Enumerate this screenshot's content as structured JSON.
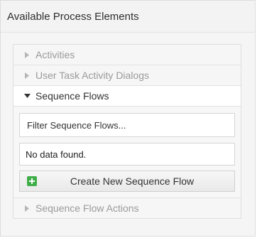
{
  "panel": {
    "title": "Available Process Elements"
  },
  "accordion": {
    "activities_label": "Activities",
    "dialogs_label": "User Task Activity Dialogs",
    "sequence_flows_label": "Sequence Flows",
    "sequence_flow_actions_label": "Sequence Flow Actions"
  },
  "sequence_flows": {
    "filter_placeholder": "Filter Sequence Flows...",
    "empty_text": "No data found.",
    "create_button_label": "Create New Sequence Flow"
  },
  "icons": {
    "collapsed": "caret-right-icon",
    "expanded": "caret-down-icon",
    "add": "plus-square-icon"
  },
  "colors": {
    "add_icon": "#3fae49"
  }
}
